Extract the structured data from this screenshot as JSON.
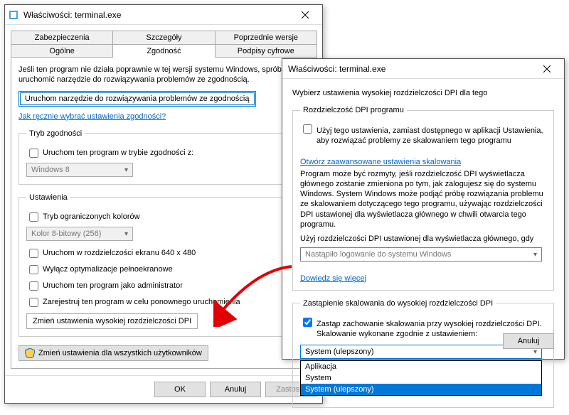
{
  "dialog1": {
    "title": "Właściwości: terminal.exe",
    "tabs_row1": [
      {
        "label": "Zabezpieczenia"
      },
      {
        "label": "Szczegóły"
      },
      {
        "label": "Poprzednie wersje"
      }
    ],
    "tabs_row2": [
      {
        "label": "Ogólne"
      },
      {
        "label": "Zgodność",
        "active": true
      },
      {
        "label": "Podpisy cyfrowe"
      }
    ],
    "intro": "Jeśli ten program nie działa poprawnie w tej wersji systemu Windows, spróbuj uruchomić narzędzie do rozwiązywania problemów ze zgodnością.",
    "run_troubleshooter": "Uruchom narzędzie do rozwiązywania problemów ze zgodnością",
    "manual_link": "Jak ręcznie wybrać ustawienia zgodności?",
    "compat_legend": "Tryb zgodności",
    "compat_run": "Uruchom ten program w trybie zgodności z:",
    "compat_os": "Windows 8",
    "settings_legend": "Ustawienia",
    "limited_colors": "Tryb ograniczonych kolorów",
    "color_mode": "Kolor 8-bitowy (256)",
    "run_640": "Uruchom w rozdzielczości ekranu 640 x 480",
    "disable_fullscreen_opt": "Wyłącz optymalizacje pełnoekranowe",
    "run_admin": "Uruchom ten program jako administrator",
    "register_restart": "Zarejestruj ten program w celu ponownego uruchomienia",
    "change_dpi": "Zmień ustawienia wysokiej rozdzielczości DPI",
    "change_all_users": "Zmień ustawienia dla wszystkich użytkowników",
    "ok": "OK",
    "cancel": "Anuluj",
    "apply": "Zastosuj"
  },
  "dialog2": {
    "title": "Właściwości: terminal.exe",
    "choose_label": "Wybierz ustawienia wysokiej rozdzielczości DPI dla tego",
    "dpi_program_legend": "Rozdzielczość DPI programu",
    "use_setting": "Użyj tego ustawienia, zamiast dostępnego w aplikacji Ustawienia, aby rozwiązać problemy ze skalowaniem tego programu",
    "open_advanced": "Otwórz zaawansowane ustawienia skalowania",
    "explain": "Program może być rozmyty, jeśli rozdzielczość DPI wyświetlacza głównego zostanie zmieniona po tym, jak zalogujesz się do systemu Windows. System Windows może podjąć próbę rozwiązania problemu ze skalowaniem dotyczącego tego programu, używając rozdzielczości DPI ustawionej dla wyświetlacza głównego w chwili otwarcia tego programu.",
    "use_main_dpi": "Użyj rozdzielczości DPI ustawionej dla wyświetlacza głównego, gdy",
    "logon_option": "Nastąpiło logowanie do systemu Windows",
    "learn_more": "Dowiedz się więcej",
    "override_legend": "Zastąpienie skalowania do wysokiej rozdzielczości DPI",
    "override_chk": "Zastąp zachowanie skalowania przy wysokiej rozdzielczości DPI. Skalowanie wykonane zgodnie z ustawieniem:",
    "dd_selected": "System (ulepszony)",
    "dd_options": [
      "Aplikacja",
      "System",
      "System (ulepszony)"
    ],
    "cancel": "Anuluj"
  }
}
